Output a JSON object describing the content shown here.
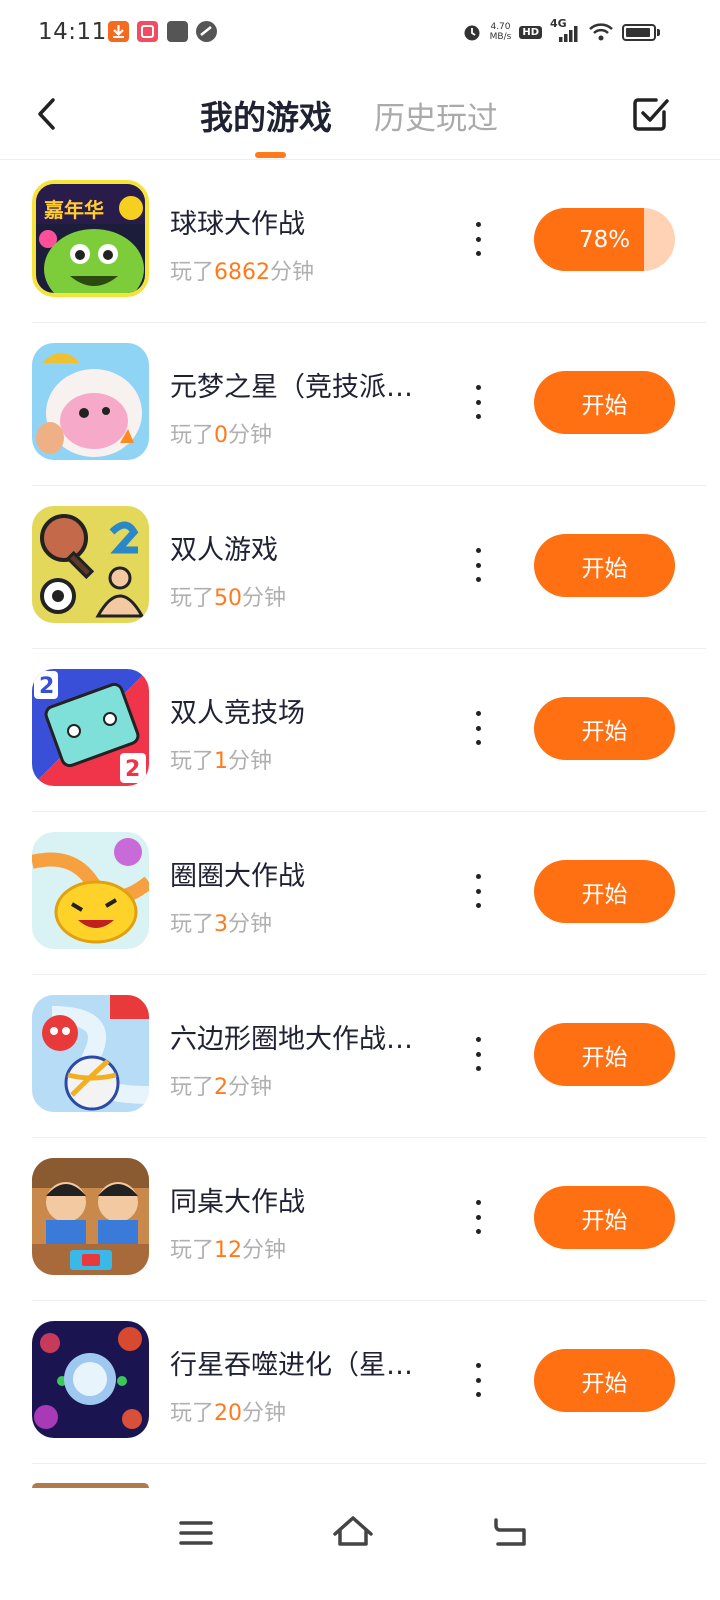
{
  "status_bar": {
    "time": "14:11",
    "net_speed_value": "4.70",
    "net_speed_unit": "MB/s",
    "hd": "HD",
    "network": "4G"
  },
  "header": {
    "tab_active": "我的游戏",
    "tab_inactive": "历史玩过"
  },
  "games": [
    {
      "name": "球球大作战",
      "played_prefix": "玩了",
      "minutes": "6862",
      "played_suffix": "分钟",
      "action": "78%",
      "progress": 0.78
    },
    {
      "name": "元梦之星（竞技派…",
      "played_prefix": "玩了",
      "minutes": "0",
      "played_suffix": "分钟",
      "action": "开始"
    },
    {
      "name": "双人游戏",
      "played_prefix": "玩了",
      "minutes": "50",
      "played_suffix": "分钟",
      "action": "开始"
    },
    {
      "name": "双人竞技场",
      "played_prefix": "玩了",
      "minutes": "1",
      "played_suffix": "分钟",
      "action": "开始"
    },
    {
      "name": "圈圈大作战",
      "played_prefix": "玩了",
      "minutes": "3",
      "played_suffix": "分钟",
      "action": "开始"
    },
    {
      "name": "六边形圈地大作战…",
      "played_prefix": "玩了",
      "minutes": "2",
      "played_suffix": "分钟",
      "action": "开始"
    },
    {
      "name": "同桌大作战",
      "played_prefix": "玩了",
      "minutes": "12",
      "played_suffix": "分钟",
      "action": "开始"
    },
    {
      "name": "行星吞噬进化（星…",
      "played_prefix": "玩了",
      "minutes": "20",
      "played_suffix": "分钟",
      "action": "开始"
    }
  ],
  "colors": {
    "accent": "#ff7012",
    "accent_light": "#ffd2b3",
    "title": "#1f2233",
    "muted": "#b0b0b0"
  },
  "icons": {
    "back": "chevron-left-icon",
    "manage": "checkbox-edit-icon",
    "more": "more-vertical-icon",
    "nav_menu": "menu-icon",
    "nav_home": "home-icon",
    "nav_back": "return-icon"
  }
}
